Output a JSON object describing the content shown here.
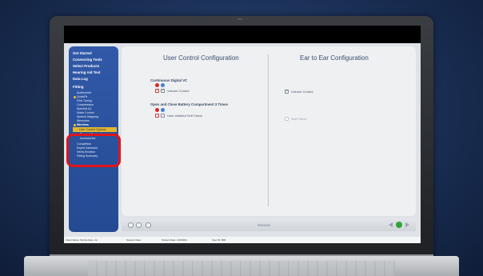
{
  "sidebar": {
    "items": [
      "Get Started",
      "Connecting Tools",
      "Select Products",
      "Hearing Aid Test",
      "Data Log",
      "Fitting"
    ],
    "fitting_subitems": [
      "Audiometer",
      "QuickFit",
      "Fine Tuning",
      "Compression",
      "Spectral IQ",
      "Noise Control",
      "Speech Mapping",
      "Memories",
      "Wireless"
    ],
    "wireless_subitems": [
      "User Control Options",
      "Binaural Processing",
      "Accessories"
    ],
    "after_items": [
      "Completion",
      "Expert Assistant",
      "Verify Emotion",
      "Fitting Summary"
    ]
  },
  "main": {
    "left_title": "User Control Configuration",
    "right_title": "Ear to Ear Configuration",
    "group1_label": "Continuous Digital VC",
    "group1_checkbox": "Volume Control",
    "group2_label": "Open and Close Battery Compartment 3 Times",
    "group2_checkbox": "User-Initiated Self Check",
    "right_checkbox1": "Volume Control",
    "right_checkbox2": "Self Check"
  },
  "bottom": {
    "wireless_tab": "Wireless"
  },
  "status": {
    "s1": "Client Name: TechnoCare, Inc",
    "s2": "Session Date:",
    "s3": "Today's Date: 1/20/2011",
    "s4": "User ID: IBM"
  },
  "colors": {
    "sidebar_bg": "#2a55a0",
    "highlight": "#e0b733",
    "annotation": "#e0151b",
    "go_button": "#2fa43a"
  }
}
